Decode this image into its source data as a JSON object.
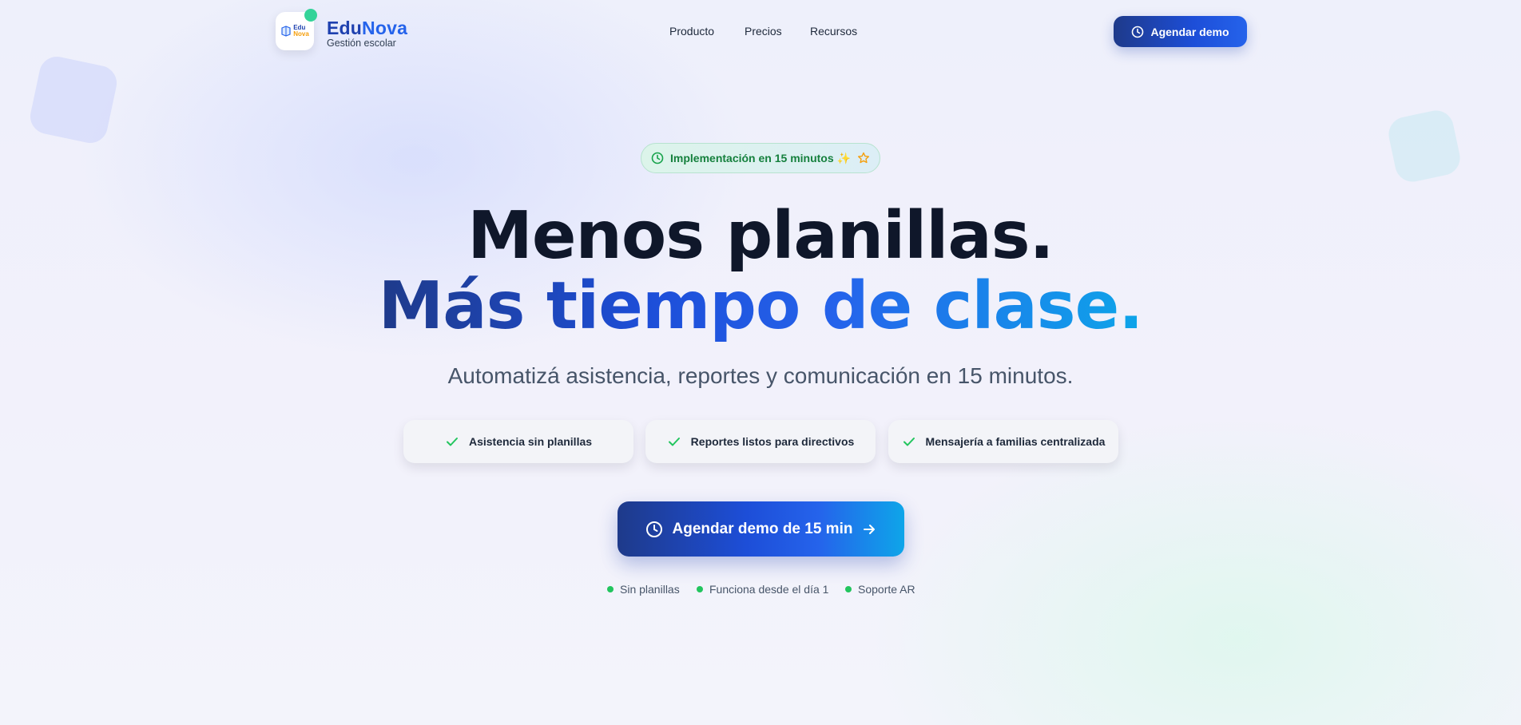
{
  "brand": {
    "name_part1": "Edu",
    "name_part2": "Nova",
    "subtitle": "Gestión escolar",
    "logo_mini_line1": "Edu",
    "logo_mini_line2": "Nova"
  },
  "nav": {
    "items": [
      {
        "label": "Producto"
      },
      {
        "label": "Precios"
      },
      {
        "label": "Recursos"
      }
    ]
  },
  "header_cta": {
    "label": "Agendar demo",
    "icon": "clock-icon"
  },
  "badge": {
    "text": "Implementación en 15 minutos ✨",
    "icon": "clock-icon",
    "trailing_icon": "star-icon"
  },
  "hero": {
    "line1": "Menos planillas.",
    "line2": "Más tiempo de clase.",
    "subtitle": "Automatizá asistencia, reportes y comunicación en 15 minutos."
  },
  "features": [
    {
      "label": "Asistencia sin planillas",
      "icon": "check-icon"
    },
    {
      "label": "Reportes listos para directivos",
      "icon": "check-icon"
    },
    {
      "label": "Mensajería a familias centralizada",
      "icon": "check-icon"
    }
  ],
  "main_cta": {
    "label": "Agendar demo de 15 min",
    "icon": "clock-icon",
    "trailing_icon": "arrow-right-icon"
  },
  "trust": [
    {
      "label": "Sin planillas"
    },
    {
      "label": "Funciona desde el día 1"
    },
    {
      "label": "Soporte AR"
    }
  ],
  "colors": {
    "primary_dark": "#1e3a8a",
    "primary": "#2563eb",
    "accent_cyan": "#0ea5e9",
    "success": "#22c55e",
    "text": "#0f172a"
  }
}
